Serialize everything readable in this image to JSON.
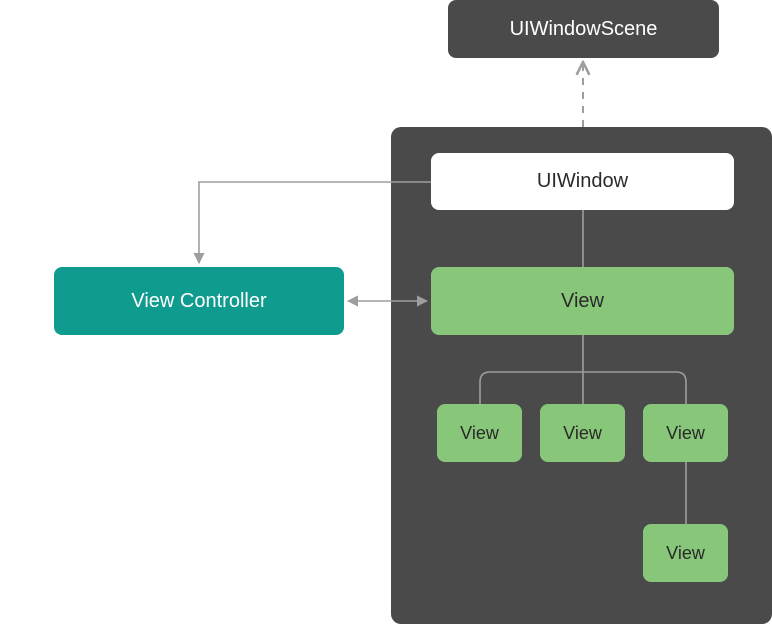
{
  "diagram": {
    "windowScene": "UIWindowScene",
    "window": "UIWindow",
    "viewController": "View Controller",
    "rootView": "View",
    "childViews": [
      "View",
      "View",
      "View"
    ],
    "grandchildView": "View"
  },
  "colors": {
    "dark": "#4a4a4a",
    "teal": "#0f9b8e",
    "green": "#88c77a",
    "line": "#9e9e9e"
  }
}
